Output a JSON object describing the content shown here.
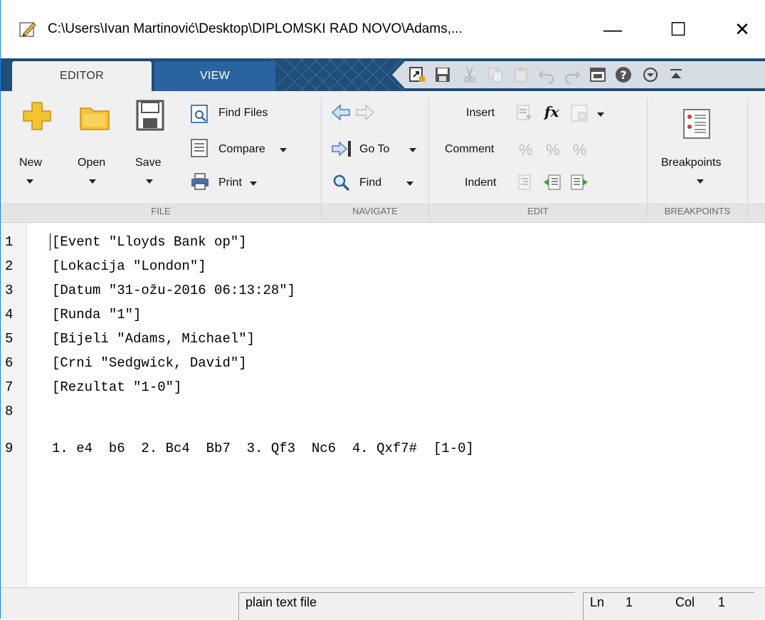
{
  "window": {
    "title": "C:\\Users\\Ivan Martinović\\Desktop\\DIPLOMSKI RAD NOVO\\Adams,...",
    "minimize_glyph": "—",
    "maximize_glyph": "☐",
    "close_glyph": "✕"
  },
  "tabs": [
    {
      "label": "EDITOR",
      "selected": true
    },
    {
      "label": "VIEW",
      "selected": false
    }
  ],
  "ribbon": {
    "file": {
      "group_label": "FILE",
      "new_label": "New",
      "open_label": "Open",
      "save_label": "Save",
      "find_files_label": "Find Files",
      "compare_label": "Compare",
      "print_label": "Print"
    },
    "navigate": {
      "group_label": "NAVIGATE",
      "goto_label": "Go To",
      "find_label": "Find"
    },
    "edit": {
      "group_label": "EDIT",
      "insert_label": "Insert",
      "comment_label": "Comment",
      "indent_label": "Indent",
      "fx_label": "fx"
    },
    "breakpoints": {
      "group_label": "BREAKPOINTS",
      "breakpoints_label": "Breakpoints"
    }
  },
  "editor": {
    "lines": [
      {
        "num": "1",
        "text": "[Event \"Lloyds Bank op\"]"
      },
      {
        "num": "2",
        "text": "[Lokacija \"London\"]"
      },
      {
        "num": "3",
        "text": "[Datum \"31-ožu-2016 06:13:28\"]"
      },
      {
        "num": "4",
        "text": "[Runda \"1\"]"
      },
      {
        "num": "5",
        "text": "[Bijeli \"Adams, Michael\"]"
      },
      {
        "num": "6",
        "text": "[Crni \"Sedgwick, David\"]"
      },
      {
        "num": "7",
        "text": "[Rezultat \"1-0\"]"
      },
      {
        "num": "8",
        "text": ""
      },
      {
        "num": "9",
        "text": "1. e4  b6  2. Bc4  Bb7  3. Qf3  Nc6  4. Qxf7#  [1-0]"
      }
    ]
  },
  "status": {
    "file_type": "plain text file",
    "ln_label": "Ln",
    "ln_value": "1",
    "col_label": "Col",
    "col_value": "1"
  },
  "colors": {
    "tabstrip": "#1e4e79",
    "ribbon": "#f0f0f0",
    "accent_blue": "#1883d7"
  }
}
